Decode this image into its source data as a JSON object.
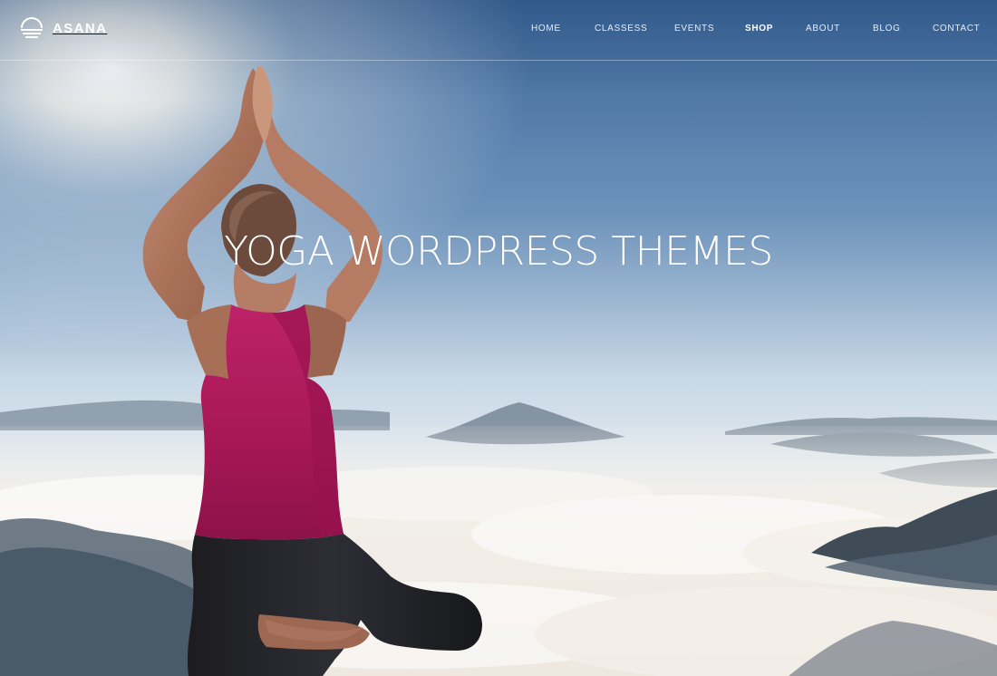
{
  "header": {
    "logo_text": "ASANA",
    "nav": [
      {
        "label": "HOME",
        "active": false
      },
      {
        "label": "CLASSESS",
        "active": false
      },
      {
        "label": "EVENTS",
        "active": false
      },
      {
        "label": "SHOP",
        "active": true
      },
      {
        "label": "ABOUT",
        "active": false
      },
      {
        "label": "BLOG",
        "active": false
      },
      {
        "label": "CONTACT",
        "active": false
      }
    ]
  },
  "hero": {
    "title": "YOGA WORDPRESS THEMES"
  },
  "colors": {
    "nav_text": "#ffffff",
    "tank_top": "#b01b5e",
    "leggings": "#1f2024",
    "sky_top": "#2f5d93",
    "sky_horizon": "#dbe6ef"
  }
}
